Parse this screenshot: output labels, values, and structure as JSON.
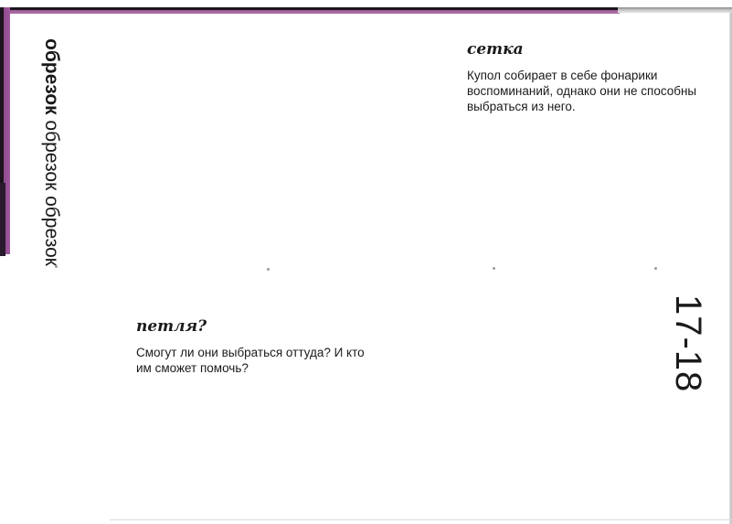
{
  "side_header": {
    "bold_word": "обрезок",
    "light_words": " обрезок обрезок"
  },
  "page_number": "17-18",
  "blocks": [
    {
      "heading": "сетка",
      "text": "Купол собирает в себе фонарики воспоминаний, однако они не способны выбраться из него."
    },
    {
      "heading": "петля?",
      "text": "Смогут ли они выбраться оттуда? И кто им сможет помочь?"
    }
  ],
  "colors": {
    "edge_purple": "#9a5a96",
    "edge_dark": "#1e1620",
    "text": "#1a1a1a"
  }
}
